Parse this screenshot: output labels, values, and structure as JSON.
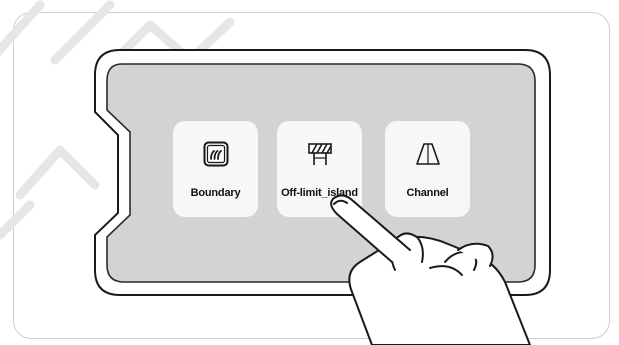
{
  "screen": {
    "accent_color": "#d3d3d3",
    "tile_color": "#f7f7f7"
  },
  "tiles": [
    {
      "label": "Boundary",
      "icon": "boundary-icon"
    },
    {
      "label": "Off-limit_island",
      "icon": "off-limit-island-icon"
    },
    {
      "label": "Channel",
      "icon": "channel-icon"
    }
  ]
}
